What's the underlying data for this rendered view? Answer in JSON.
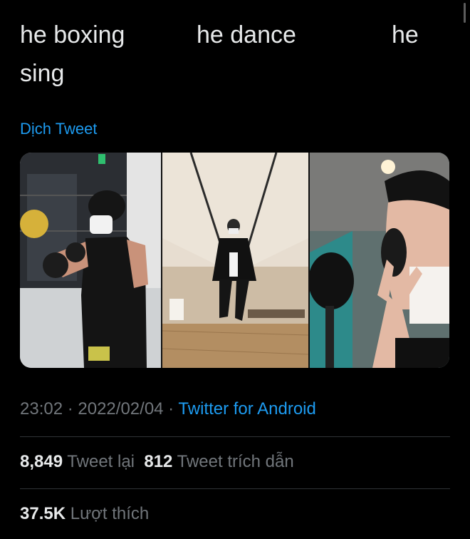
{
  "tweet": {
    "text_parts": [
      "he boxing",
      "he dance",
      "he",
      "sing"
    ],
    "translate_label": "Dịch Tweet"
  },
  "media": {
    "panels": [
      "boxing-photo",
      "dance-photo",
      "singing-selfie-photo"
    ]
  },
  "meta": {
    "time": "23:02",
    "sep1": " · ",
    "date": "2022/02/04",
    "sep2": " · ",
    "source": "Twitter for Android"
  },
  "stats": {
    "retweets_count": "8,849",
    "retweets_label": "Tweet lại",
    "quotes_count": "812",
    "quotes_label": "Tweet trích dẫn",
    "likes_count": "37.5K",
    "likes_label": "Lượt thích"
  },
  "colors": {
    "background": "#000000",
    "text": "#e7e9ea",
    "muted": "#71767b",
    "accent": "#1d9bf0",
    "divider": "#2f3336"
  }
}
